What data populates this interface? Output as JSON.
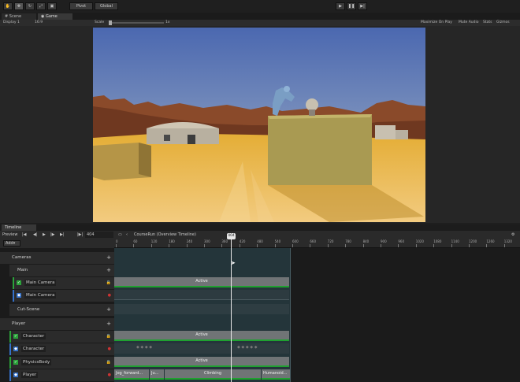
{
  "toolbar": {
    "pivot": "Pivot",
    "global": "Global"
  },
  "tabs": [
    "Scene",
    "Game"
  ],
  "gamebar": {
    "display": "Display 1",
    "aspect": "16:9",
    "scale_label": "Scale",
    "scale_value": "1x",
    "maximize": "Maximize On Play",
    "mute": "Mute Audio",
    "stats": "Stats",
    "gizmos": "Gizmos"
  },
  "timeline": {
    "tab": "Timeline",
    "preview": "Preview",
    "frame": "404",
    "title": "CourseRun (Overview Timeline)",
    "add": "Add",
    "playhead": "404",
    "ruler_ticks": [
      "0",
      "60",
      "120",
      "180",
      "240",
      "300",
      "360",
      "420",
      "480",
      "540",
      "600",
      "660",
      "720",
      "780",
      "840",
      "900",
      "960",
      "1020",
      "1080",
      "1140",
      "1200",
      "1260",
      "1320"
    ],
    "tracks": {
      "cameras": "Cameras",
      "main": "Main",
      "main_camera_1": "Main Camera",
      "main_camera_2": "Main Camera",
      "cut_scene": "Cut-Scene",
      "player": "Player",
      "character_1": "Character",
      "character_2": "Character",
      "physics_body": "PhysicsBody",
      "player_track": "Player"
    },
    "clips": {
      "main_active": "Active",
      "character_active": "Active",
      "physics_active": "Active",
      "player_c1": "Jog_forward...",
      "player_c2": "Ju...",
      "player_c3": "Climbing",
      "player_c4": "Humanoid..."
    }
  }
}
